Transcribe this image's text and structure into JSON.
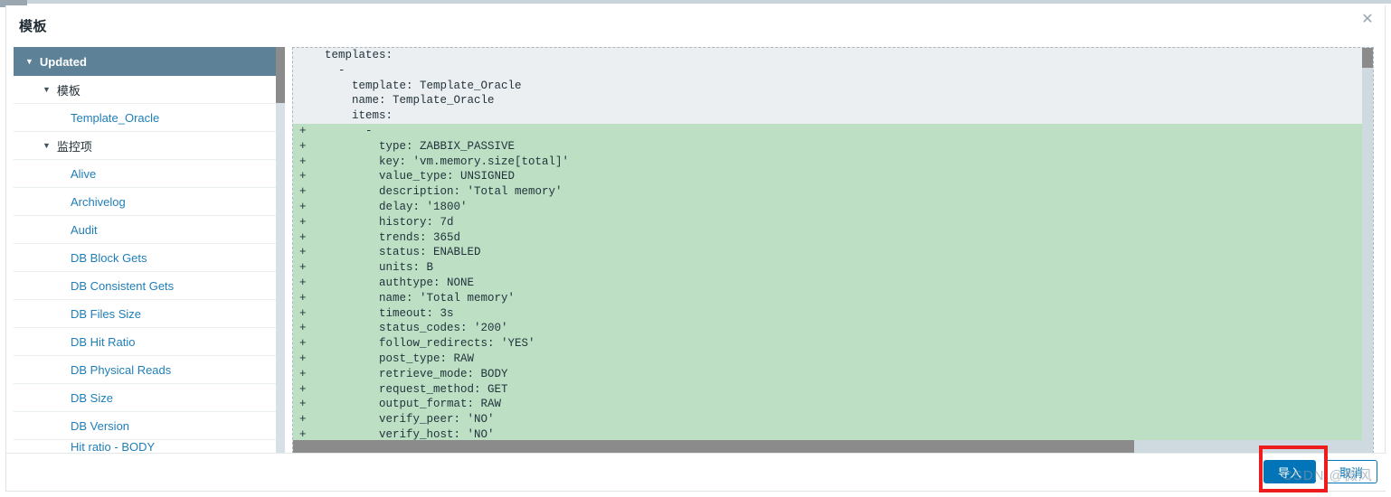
{
  "dialog": {
    "title": "模板",
    "close_icon": "close-icon",
    "close_glyph": "✕"
  },
  "tree": {
    "header": {
      "label": "Updated",
      "caret": "▼"
    },
    "nodes": [
      {
        "type": "group",
        "label": "模板",
        "caret": "▼"
      },
      {
        "type": "item",
        "label": "Template_Oracle"
      },
      {
        "type": "group",
        "label": "监控项",
        "caret": "▼"
      },
      {
        "type": "item",
        "label": "Alive"
      },
      {
        "type": "item",
        "label": "Archivelog"
      },
      {
        "type": "item",
        "label": "Audit"
      },
      {
        "type": "item",
        "label": "DB Block Gets"
      },
      {
        "type": "item",
        "label": "DB Consistent Gets"
      },
      {
        "type": "item",
        "label": "DB Files Size"
      },
      {
        "type": "item",
        "label": "DB Hit Ratio"
      },
      {
        "type": "item",
        "label": "DB Physical Reads"
      },
      {
        "type": "item",
        "label": "DB Size"
      },
      {
        "type": "item",
        "label": "DB Version"
      },
      {
        "type": "item",
        "label": "Hit ratio - BODY",
        "clipped": true
      }
    ]
  },
  "code": {
    "lines": [
      {
        "mark": "",
        "text": "  templates:",
        "kind": "ctx"
      },
      {
        "mark": "",
        "text": "    -",
        "kind": "ctx"
      },
      {
        "mark": "",
        "text": "      template: Template_Oracle",
        "kind": "ctx"
      },
      {
        "mark": "",
        "text": "      name: Template_Oracle",
        "kind": "ctx"
      },
      {
        "mark": "",
        "text": "      items:",
        "kind": "ctx"
      },
      {
        "mark": "+",
        "text": "        -",
        "kind": "add"
      },
      {
        "mark": "+",
        "text": "          type: ZABBIX_PASSIVE",
        "kind": "add"
      },
      {
        "mark": "+",
        "text": "          key: 'vm.memory.size[total]'",
        "kind": "add"
      },
      {
        "mark": "+",
        "text": "          value_type: UNSIGNED",
        "kind": "add"
      },
      {
        "mark": "+",
        "text": "          description: 'Total memory'",
        "kind": "add"
      },
      {
        "mark": "+",
        "text": "          delay: '1800'",
        "kind": "add"
      },
      {
        "mark": "+",
        "text": "          history: 7d",
        "kind": "add"
      },
      {
        "mark": "+",
        "text": "          trends: 365d",
        "kind": "add"
      },
      {
        "mark": "+",
        "text": "          status: ENABLED",
        "kind": "add"
      },
      {
        "mark": "+",
        "text": "          units: B",
        "kind": "add"
      },
      {
        "mark": "+",
        "text": "          authtype: NONE",
        "kind": "add"
      },
      {
        "mark": "+",
        "text": "          name: 'Total memory'",
        "kind": "add"
      },
      {
        "mark": "+",
        "text": "          timeout: 3s",
        "kind": "add"
      },
      {
        "mark": "+",
        "text": "          status_codes: '200'",
        "kind": "add"
      },
      {
        "mark": "+",
        "text": "          follow_redirects: 'YES'",
        "kind": "add"
      },
      {
        "mark": "+",
        "text": "          post_type: RAW",
        "kind": "add"
      },
      {
        "mark": "+",
        "text": "          retrieve_mode: BODY",
        "kind": "add"
      },
      {
        "mark": "+",
        "text": "          request_method: GET",
        "kind": "add"
      },
      {
        "mark": "+",
        "text": "          output_format: RAW",
        "kind": "add"
      },
      {
        "mark": "+",
        "text": "          verify_peer: 'NO'",
        "kind": "add"
      },
      {
        "mark": "+",
        "text": "          verify_host: 'NO'",
        "kind": "add"
      }
    ]
  },
  "footer": {
    "import_label": "导入",
    "cancel_label": "取消"
  },
  "watermark": {
    "text": "CSDN @微风"
  },
  "colors": {
    "tree_header_bg": "#5d8298",
    "link": "#1f7eb8",
    "diff_add_bg": "#bde0c4",
    "diff_ctx_bg": "#eceff1",
    "primary_button": "#0275b8",
    "annotation_red": "#ee1c1c"
  }
}
